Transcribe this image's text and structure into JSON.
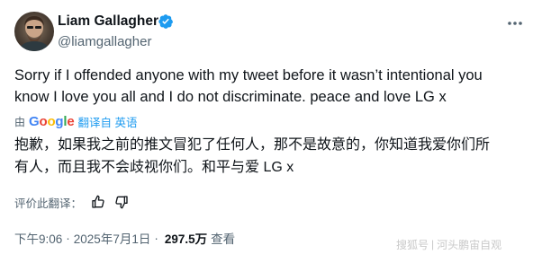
{
  "profile": {
    "name": "Liam Gallagher",
    "handle": "@liamgallagher"
  },
  "tweet": {
    "line1": "Sorry if I offended anyone with my tweet before it wasn’t intentional you",
    "line2": "know I love you all and I do not discriminate. peace and love LG x"
  },
  "translation": {
    "by_prefix": "由",
    "provider": "Google",
    "from_label": "翻译自 英语",
    "line1": "抱歉，如果我之前的推文冒犯了任何人，那不是故意的，你知道我爱你们所",
    "line2": "有人，而且我不会歧视你们。和平与爱 LG x",
    "rate_label": "评价此翻译："
  },
  "meta": {
    "time": "下午9:06",
    "separator": "·",
    "date": "2025年7月1日",
    "views": "297.5万",
    "views_label": "查看"
  },
  "watermark": {
    "part1": "搜狐号",
    "separator": "|",
    "part2": "河头鹏宙自观"
  },
  "icons": {
    "more": "more-dots-icon",
    "verified": "verified-badge-icon",
    "thumbs_up": "thumbs-up-icon",
    "thumbs_down": "thumbs-down-icon"
  },
  "colors": {
    "verified_blue": "#1d9bf0",
    "link_blue": "#1d9bf0",
    "muted_gray": "#536471"
  }
}
